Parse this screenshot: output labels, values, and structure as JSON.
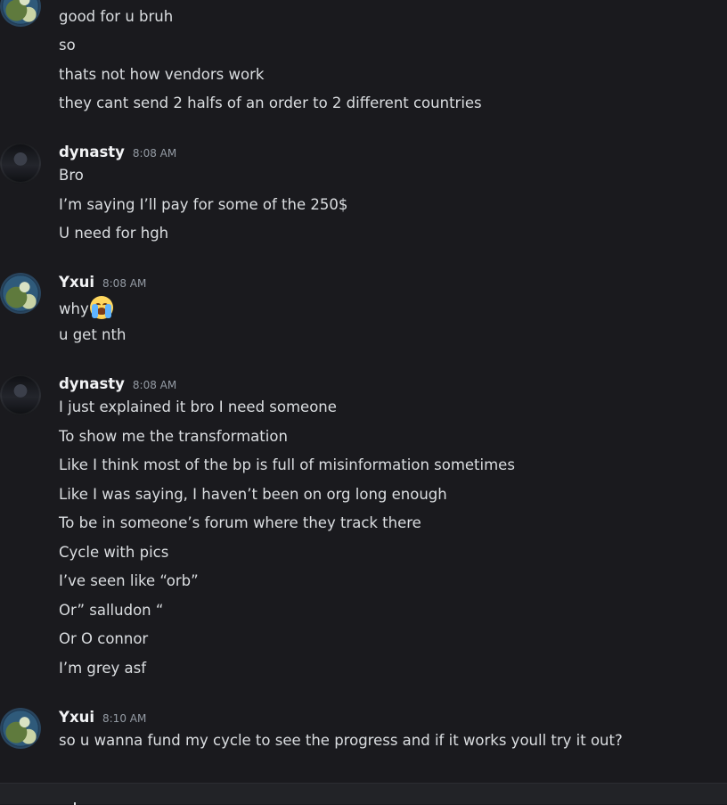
{
  "messages": {
    "group0": {
      "lines": [
        "good for u bruh",
        "so",
        "thats not how vendors work",
        "they cant send 2 halfs of an order to 2 different countries"
      ]
    },
    "group1": {
      "author": "dynasty",
      "time": "8:08 AM",
      "lines": [
        "Bro",
        "I’m saying I’ll pay for some of the 250$",
        "U need for hgh"
      ]
    },
    "group2": {
      "author": "Yxui",
      "time": "8:08 AM",
      "lines": [
        "why",
        "u get nth"
      ],
      "emoji": "loudly-crying-face"
    },
    "group3": {
      "author": "dynasty",
      "time": "8:08 AM",
      "lines": [
        "I just explained it bro I need someone",
        "To show me the transformation",
        "Like I think most of the bp is full of misinformation sometimes",
        "Like I was saying, I haven’t been on org long enough",
        "To be in someone’s forum where they track there",
        "Cycle with pics",
        "I’ve seen like “orb”",
        "Or” salludon “",
        "Or O connor",
        "I’m grey asf"
      ]
    },
    "group4": {
      "author": "Yxui",
      "time": "8:10 AM",
      "lines": [
        "so u wanna fund my cycle to see the progress and if it works youll try it out?"
      ]
    }
  },
  "colors": {
    "background": "#1a1a1e",
    "text": "#dbdee1",
    "username": "#f2f3f5",
    "timestamp": "#949ba4"
  },
  "icons": {
    "avatar_yxui": "green-figure-avatar",
    "avatar_dynasty": "dark-photo-avatar"
  }
}
